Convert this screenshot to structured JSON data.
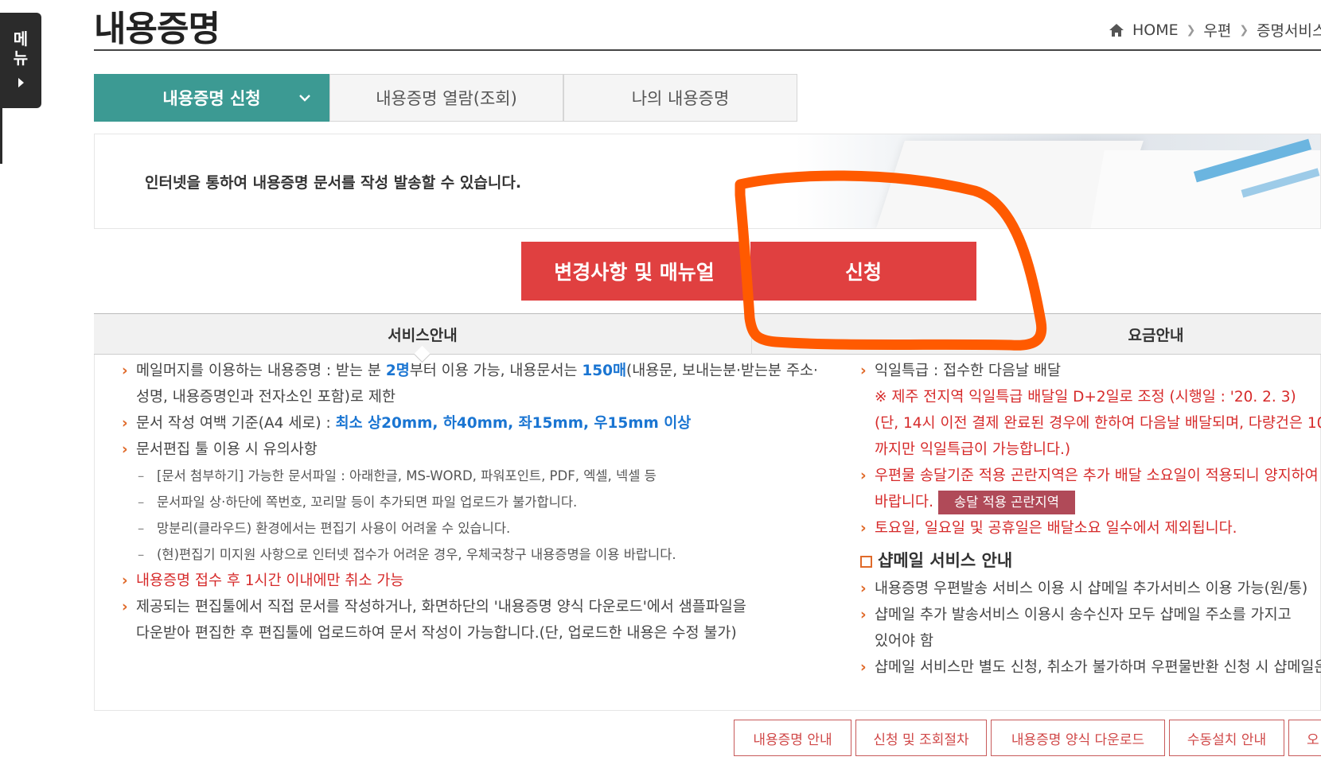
{
  "side_menu": {
    "label_top": "메",
    "label_bottom": "뉴"
  },
  "page_title": "내용증명",
  "breadcrumb": {
    "home": "HOME",
    "level1": "우편",
    "level2": "증명서비스"
  },
  "tabs": [
    {
      "label": "내용증명 신청"
    },
    {
      "label": "내용증명 열람(조회)"
    },
    {
      "label": "나의 내용증명"
    }
  ],
  "intro_text": "인터넷을 통하여 내용증명 문서를 작성 발송할 수 있습니다.",
  "buttons": {
    "manual": "변경사항 및 매뉴얼",
    "apply": "신청"
  },
  "sections": {
    "service": "서비스안내",
    "fee": "요금안내"
  },
  "service": {
    "l1a": "메일머지를 이용하는 내용증명 : 받는 분 ",
    "l1b": "2명",
    "l1c": "부터 이용 가능, 내용문서는 ",
    "l1d": "150매",
    "l1e": "(내용문, 보내는분·받는분 주소·",
    "l2": "성명, 내용증명인과 전자소인 포함)로 제한",
    "l3a": "문서 작성 여백 기준(A4 세로) : ",
    "l3b": "최소 상20mm, 하40mm, 좌15mm, 우15mm 이상",
    "l4": "문서편집 툴 이용 시 유의사항",
    "d1": "[문서 첨부하기] 가능한 문서파일 : 아래한글, MS-WORD, 파워포인트, PDF, 엑셀, 넥셀 등",
    "d2": "문서파일 상·하단에 쪽번호, 꼬리말 등이 추가되면 파일 업로드가 불가합니다.",
    "d3": "망분리(클라우드) 환경에서는 편집기 사용이 어려울 수 있습니다.",
    "d4": "(현)편집기 미지원 사항으로 인터넷 접수가 어려운 경우, 우체국창구 내용증명을 이용 바랍니다.",
    "l5": "내용증명 접수 후 1시간 이내에만 취소 가능",
    "l6": "제공되는 편집툴에서 직접 문서를 작성하거나, 화면하단의 '내용증명 양식 다운로드'에서 샘플파일을",
    "l7": "다운받아 편집한 후 편집툴에 업로드하여 문서 작성이 가능합니다.(단, 업로드한 내용은 수정 불가)"
  },
  "fee": {
    "f1": "익일특급 : 접수한 다음날 배달",
    "f2": "※ 제주 전지역 익일특급 배달일 D+2일로 조정 (시행일 : '20. 2. 3)",
    "f3": "(단, 14시 이전 결제 완료된 경우에 한하여 다음날 배달되며, 다량건은 10",
    "f4": "까지만 익일특급이 가능합니다.)",
    "f5": "우편물 송달기준 적용 곤란지역은 추가 배달 소요일이 적용되니 양지하여",
    "f6": "바랍니다.",
    "f6_button": "송달 적용 곤란지역",
    "f7": "토요일, 일요일 및 공휴일은 배달소요 일수에서 제외됩니다.",
    "shop_title": "샵메일 서비스 안내",
    "s1": "내용증명 우편발송 서비스 이용 시 샵메일 추가서비스 이용 가능(원/통)",
    "s2": "샵메일 추가 발송서비스 이용시 송수신자 모두 샵메일 주소를 가지고",
    "s3": "있어야 함",
    "s4": "샵메일 서비스만 별도 신청, 취소가 불가하며 우편물반환 신청 시 샵메일은"
  },
  "bottom_links": [
    "내용증명 안내",
    "신청 및 조회절차",
    "내용증명 양식 다운로드",
    "수동설치 안내",
    "오"
  ],
  "colors": {
    "teal": "#3c9a93",
    "red": "#e04040",
    "orange_annotation": "#ff5a00",
    "blue": "#1a75d2"
  }
}
